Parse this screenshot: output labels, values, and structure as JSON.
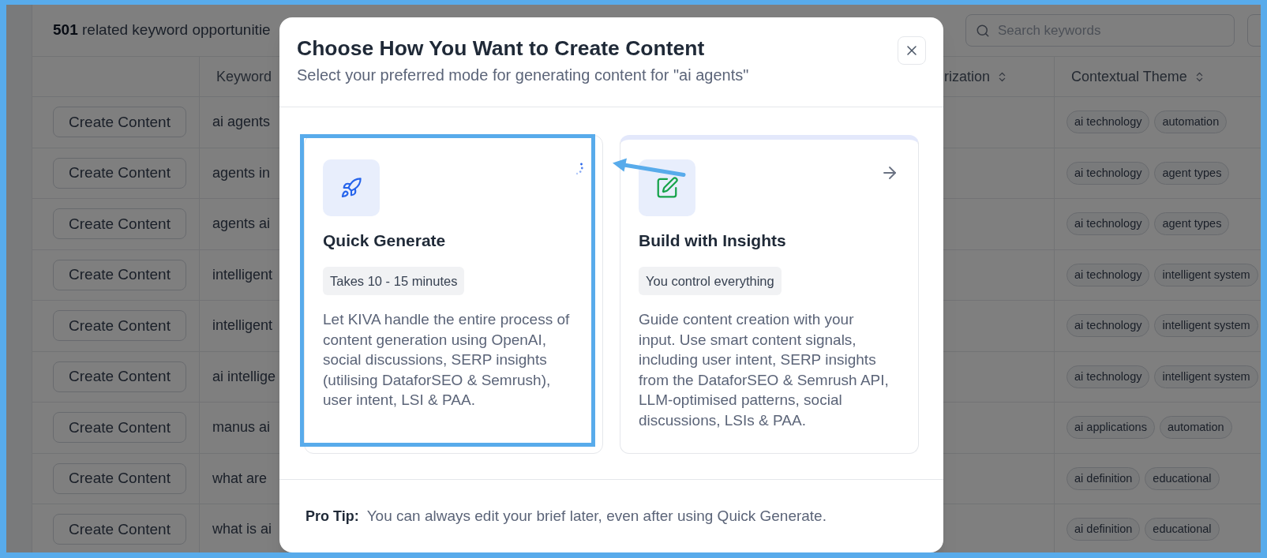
{
  "table": {
    "summary": "**501** related keyword opportunitie",
    "search": {
      "placeholder": "Search keywords"
    },
    "columns": [
      {
        "label": "Keyword"
      },
      {
        "label": "rization",
        "sortable": true
      },
      {
        "label": "Contextual Theme",
        "sortable": true
      }
    ],
    "rows": [
      {
        "action": "Create Content",
        "keyword": "ai agents",
        "themes": [
          "ai technology",
          "automation"
        ]
      },
      {
        "action": "Create Content",
        "keyword": "agents in",
        "themes": [
          "ai technology",
          "agent types"
        ]
      },
      {
        "action": "Create Content",
        "keyword": "agents ai",
        "themes": [
          "ai technology",
          "agent types"
        ]
      },
      {
        "action": "Create Content",
        "keyword": "intelligent",
        "themes": [
          "ai technology",
          "intelligent system"
        ]
      },
      {
        "action": "Create Content",
        "keyword": "intelligent",
        "themes": [
          "ai technology",
          "intelligent system"
        ]
      },
      {
        "action": "Create Content",
        "keyword": "ai intellige",
        "themes": [
          "ai technology",
          "intelligent system"
        ]
      },
      {
        "action": "Create Content",
        "keyword": "manus ai",
        "themes": [
          "ai applications",
          "automation"
        ]
      },
      {
        "action": "Create Content",
        "keyword": "what are",
        "themes": [
          "ai definition",
          "educational"
        ]
      },
      {
        "action": "Create Content",
        "keyword": "what is ai",
        "themes": [
          "ai definition",
          "educational"
        ]
      }
    ]
  },
  "modal": {
    "title": "Choose How You Want to Create Content",
    "subtitle": "Select your preferred mode for generating content for \"ai agents\"",
    "cards": [
      {
        "kind": "quick",
        "title": "Quick Generate",
        "badge": "Takes 10 - 15 minutes",
        "description": "Let KIVA handle the entire process of content generation using OpenAI, social discussions, SERP insights (utilising DataforSEO & Semrush), user intent, LSI & PAA.",
        "loading": true,
        "hovered": false,
        "highlighted": true
      },
      {
        "kind": "insights",
        "title": "Build with Insights",
        "badge": "You control everything",
        "description": "Guide content creation with your input. Use smart content signals, including user intent, SERP insights from the DataforSEO & Semrush API, LLM-optimised patterns, social discussions, LSIs & PAA.",
        "loading": false,
        "hovered": true,
        "highlighted": false
      }
    ],
    "pointer_arrow": true,
    "tip": {
      "label": "Pro Tip:",
      "text": "You can always edit your brief later, even after using Quick Generate."
    }
  }
}
